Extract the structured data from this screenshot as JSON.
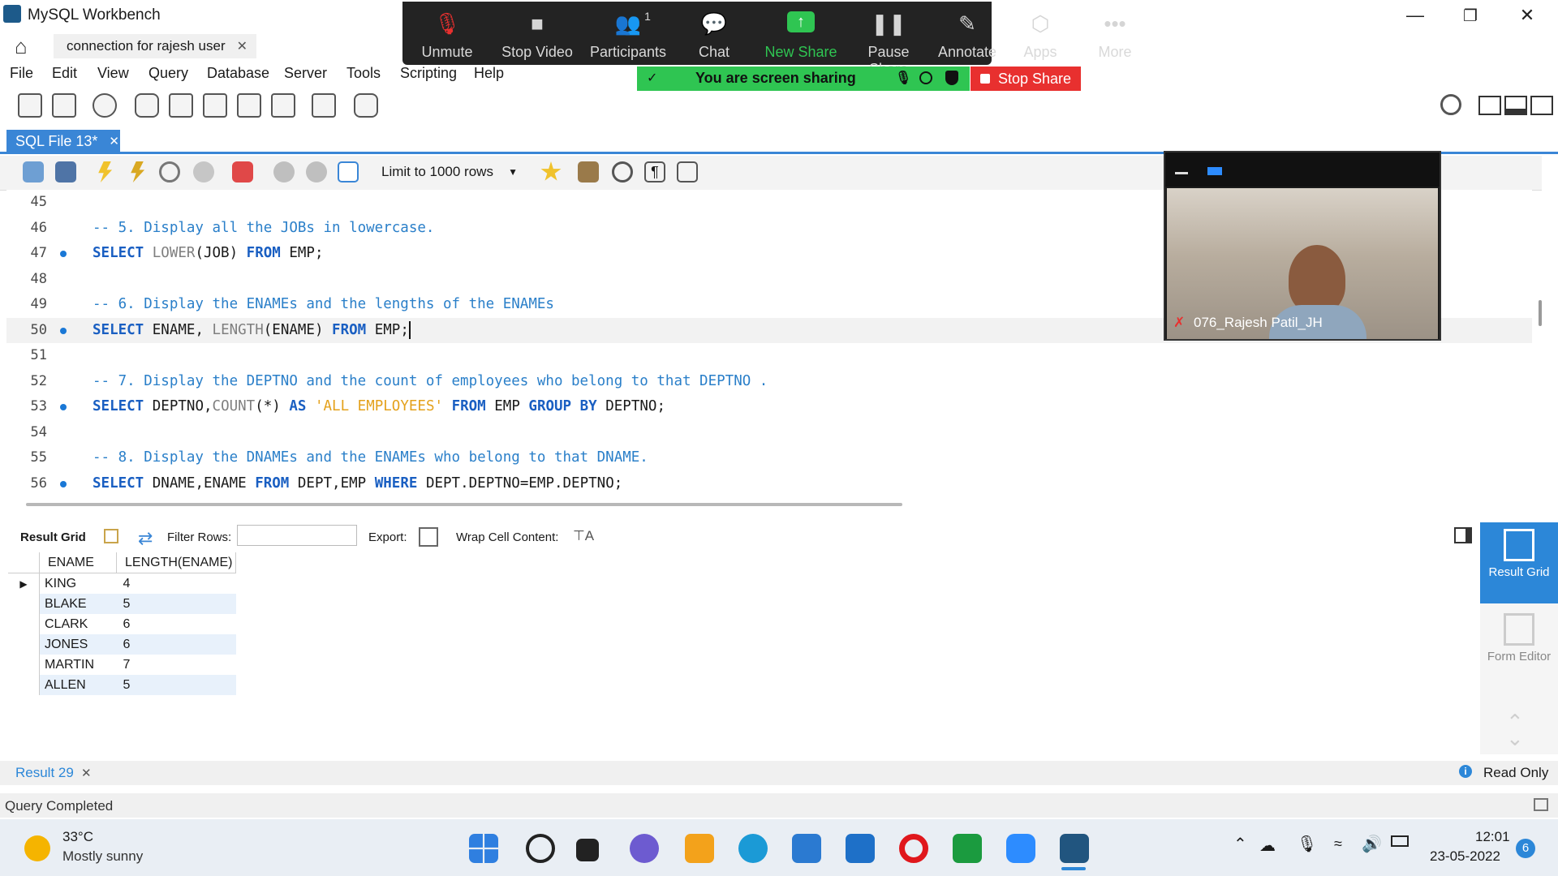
{
  "window": {
    "title": "MySQL Workbench",
    "connection_tab": "connection for rajesh user"
  },
  "menu": [
    "File",
    "Edit",
    "View",
    "Query",
    "Database",
    "Server",
    "Tools",
    "Scripting",
    "Help"
  ],
  "sql_tab": {
    "label": "SQL File 13*"
  },
  "editor_toolbar": {
    "limit_label": "Limit to 1000 rows"
  },
  "editor": {
    "lines": [
      {
        "num": "45",
        "dot": false,
        "tokens": []
      },
      {
        "num": "46",
        "dot": false,
        "tokens": [
          {
            "t": "cm",
            "v": "-- 5. Display all the JOBs in lowercase."
          }
        ]
      },
      {
        "num": "47",
        "dot": true,
        "tokens": [
          {
            "t": "kw",
            "v": "SELECT "
          },
          {
            "t": "fn",
            "v": "LOWER"
          },
          {
            "t": "id",
            "v": "(JOB) "
          },
          {
            "t": "kw",
            "v": "FROM "
          },
          {
            "t": "id",
            "v": "EMP;"
          }
        ]
      },
      {
        "num": "48",
        "dot": false,
        "tokens": []
      },
      {
        "num": "49",
        "dot": false,
        "tokens": [
          {
            "t": "cm",
            "v": "-- 6. Display the ENAMEs and the lengths of the ENAMEs"
          }
        ]
      },
      {
        "num": "50",
        "dot": true,
        "current": true,
        "tokens": [
          {
            "t": "kw",
            "v": "SELECT "
          },
          {
            "t": "id",
            "v": "ENAME, "
          },
          {
            "t": "fn",
            "v": "LENGTH"
          },
          {
            "t": "id",
            "v": "(ENAME) "
          },
          {
            "t": "kw",
            "v": "FROM "
          },
          {
            "t": "id",
            "v": "EMP;"
          }
        ]
      },
      {
        "num": "51",
        "dot": false,
        "tokens": []
      },
      {
        "num": "52",
        "dot": false,
        "tokens": [
          {
            "t": "cm",
            "v": "-- 7. Display the DEPTNO and the count of employees who belong to that DEPTNO ."
          }
        ]
      },
      {
        "num": "53",
        "dot": true,
        "tokens": [
          {
            "t": "kw",
            "v": "SELECT "
          },
          {
            "t": "id",
            "v": "DEPTNO,"
          },
          {
            "t": "fn",
            "v": "COUNT"
          },
          {
            "t": "id",
            "v": "(*) "
          },
          {
            "t": "kw",
            "v": "AS "
          },
          {
            "t": "str",
            "v": "'ALL EMPLOYEES' "
          },
          {
            "t": "kw",
            "v": "FROM "
          },
          {
            "t": "id",
            "v": "EMP "
          },
          {
            "t": "kw",
            "v": "GROUP BY "
          },
          {
            "t": "id",
            "v": "DEPTNO;"
          }
        ]
      },
      {
        "num": "54",
        "dot": false,
        "tokens": []
      },
      {
        "num": "55",
        "dot": false,
        "tokens": [
          {
            "t": "cm",
            "v": "-- 8. Display the DNAMEs and the ENAMEs who belong to that DNAME."
          }
        ]
      },
      {
        "num": "56",
        "dot": true,
        "tokens": [
          {
            "t": "kw",
            "v": "SELECT "
          },
          {
            "t": "id",
            "v": "DNAME,ENAME "
          },
          {
            "t": "kw",
            "v": "FROM "
          },
          {
            "t": "id",
            "v": "DEPT,EMP "
          },
          {
            "t": "kw",
            "v": "WHERE "
          },
          {
            "t": "id",
            "v": "DEPT.DEPTNO=EMP.DEPTNO;"
          }
        ]
      }
    ]
  },
  "result_toolbar": {
    "result_grid": "Result Grid",
    "filter_rows": "Filter Rows:",
    "export": "Export:",
    "wrap": "Wrap Cell Content:"
  },
  "result_grid": {
    "columns": [
      "ENAME",
      "LENGTH(ENAME)"
    ],
    "rows": [
      [
        "KING",
        "4"
      ],
      [
        "BLAKE",
        "5"
      ],
      [
        "CLARK",
        "6"
      ],
      [
        "JONES",
        "6"
      ],
      [
        "MARTIN",
        "7"
      ],
      [
        "ALLEN",
        "5"
      ]
    ]
  },
  "side_panel": {
    "result_grid_label": "Result Grid",
    "form_editor_label": "Form Editor"
  },
  "result_tabs": {
    "tab": "Result 29",
    "read_only": "Read Only"
  },
  "status": {
    "text": "Query Completed"
  },
  "zoom": {
    "items": [
      {
        "icon": "🎙",
        "label": "Unmute"
      },
      {
        "icon": "■",
        "label": "Stop Video"
      },
      {
        "icon": "👥",
        "label": "Participants",
        "badge": "1"
      },
      {
        "icon": "💬",
        "label": "Chat"
      },
      {
        "icon": "↑",
        "label": "New Share"
      },
      {
        "icon": "❚❚",
        "label": "Pause Share"
      },
      {
        "icon": "✎",
        "label": "Annotate"
      },
      {
        "icon": "⬡",
        "label": "Apps"
      },
      {
        "icon": "•••",
        "label": "More"
      }
    ],
    "banner": "You are screen sharing",
    "stop_share": "Stop Share",
    "participant_name": "076_Rajesh Patil_JH",
    "accent_green": "#2fc552",
    "stop_red": "#e8302f"
  },
  "taskbar": {
    "weather_temp": "33°C",
    "weather_desc": "Mostly sunny",
    "time": "12:01",
    "date": "23-05-2022",
    "notification_count": "6"
  }
}
